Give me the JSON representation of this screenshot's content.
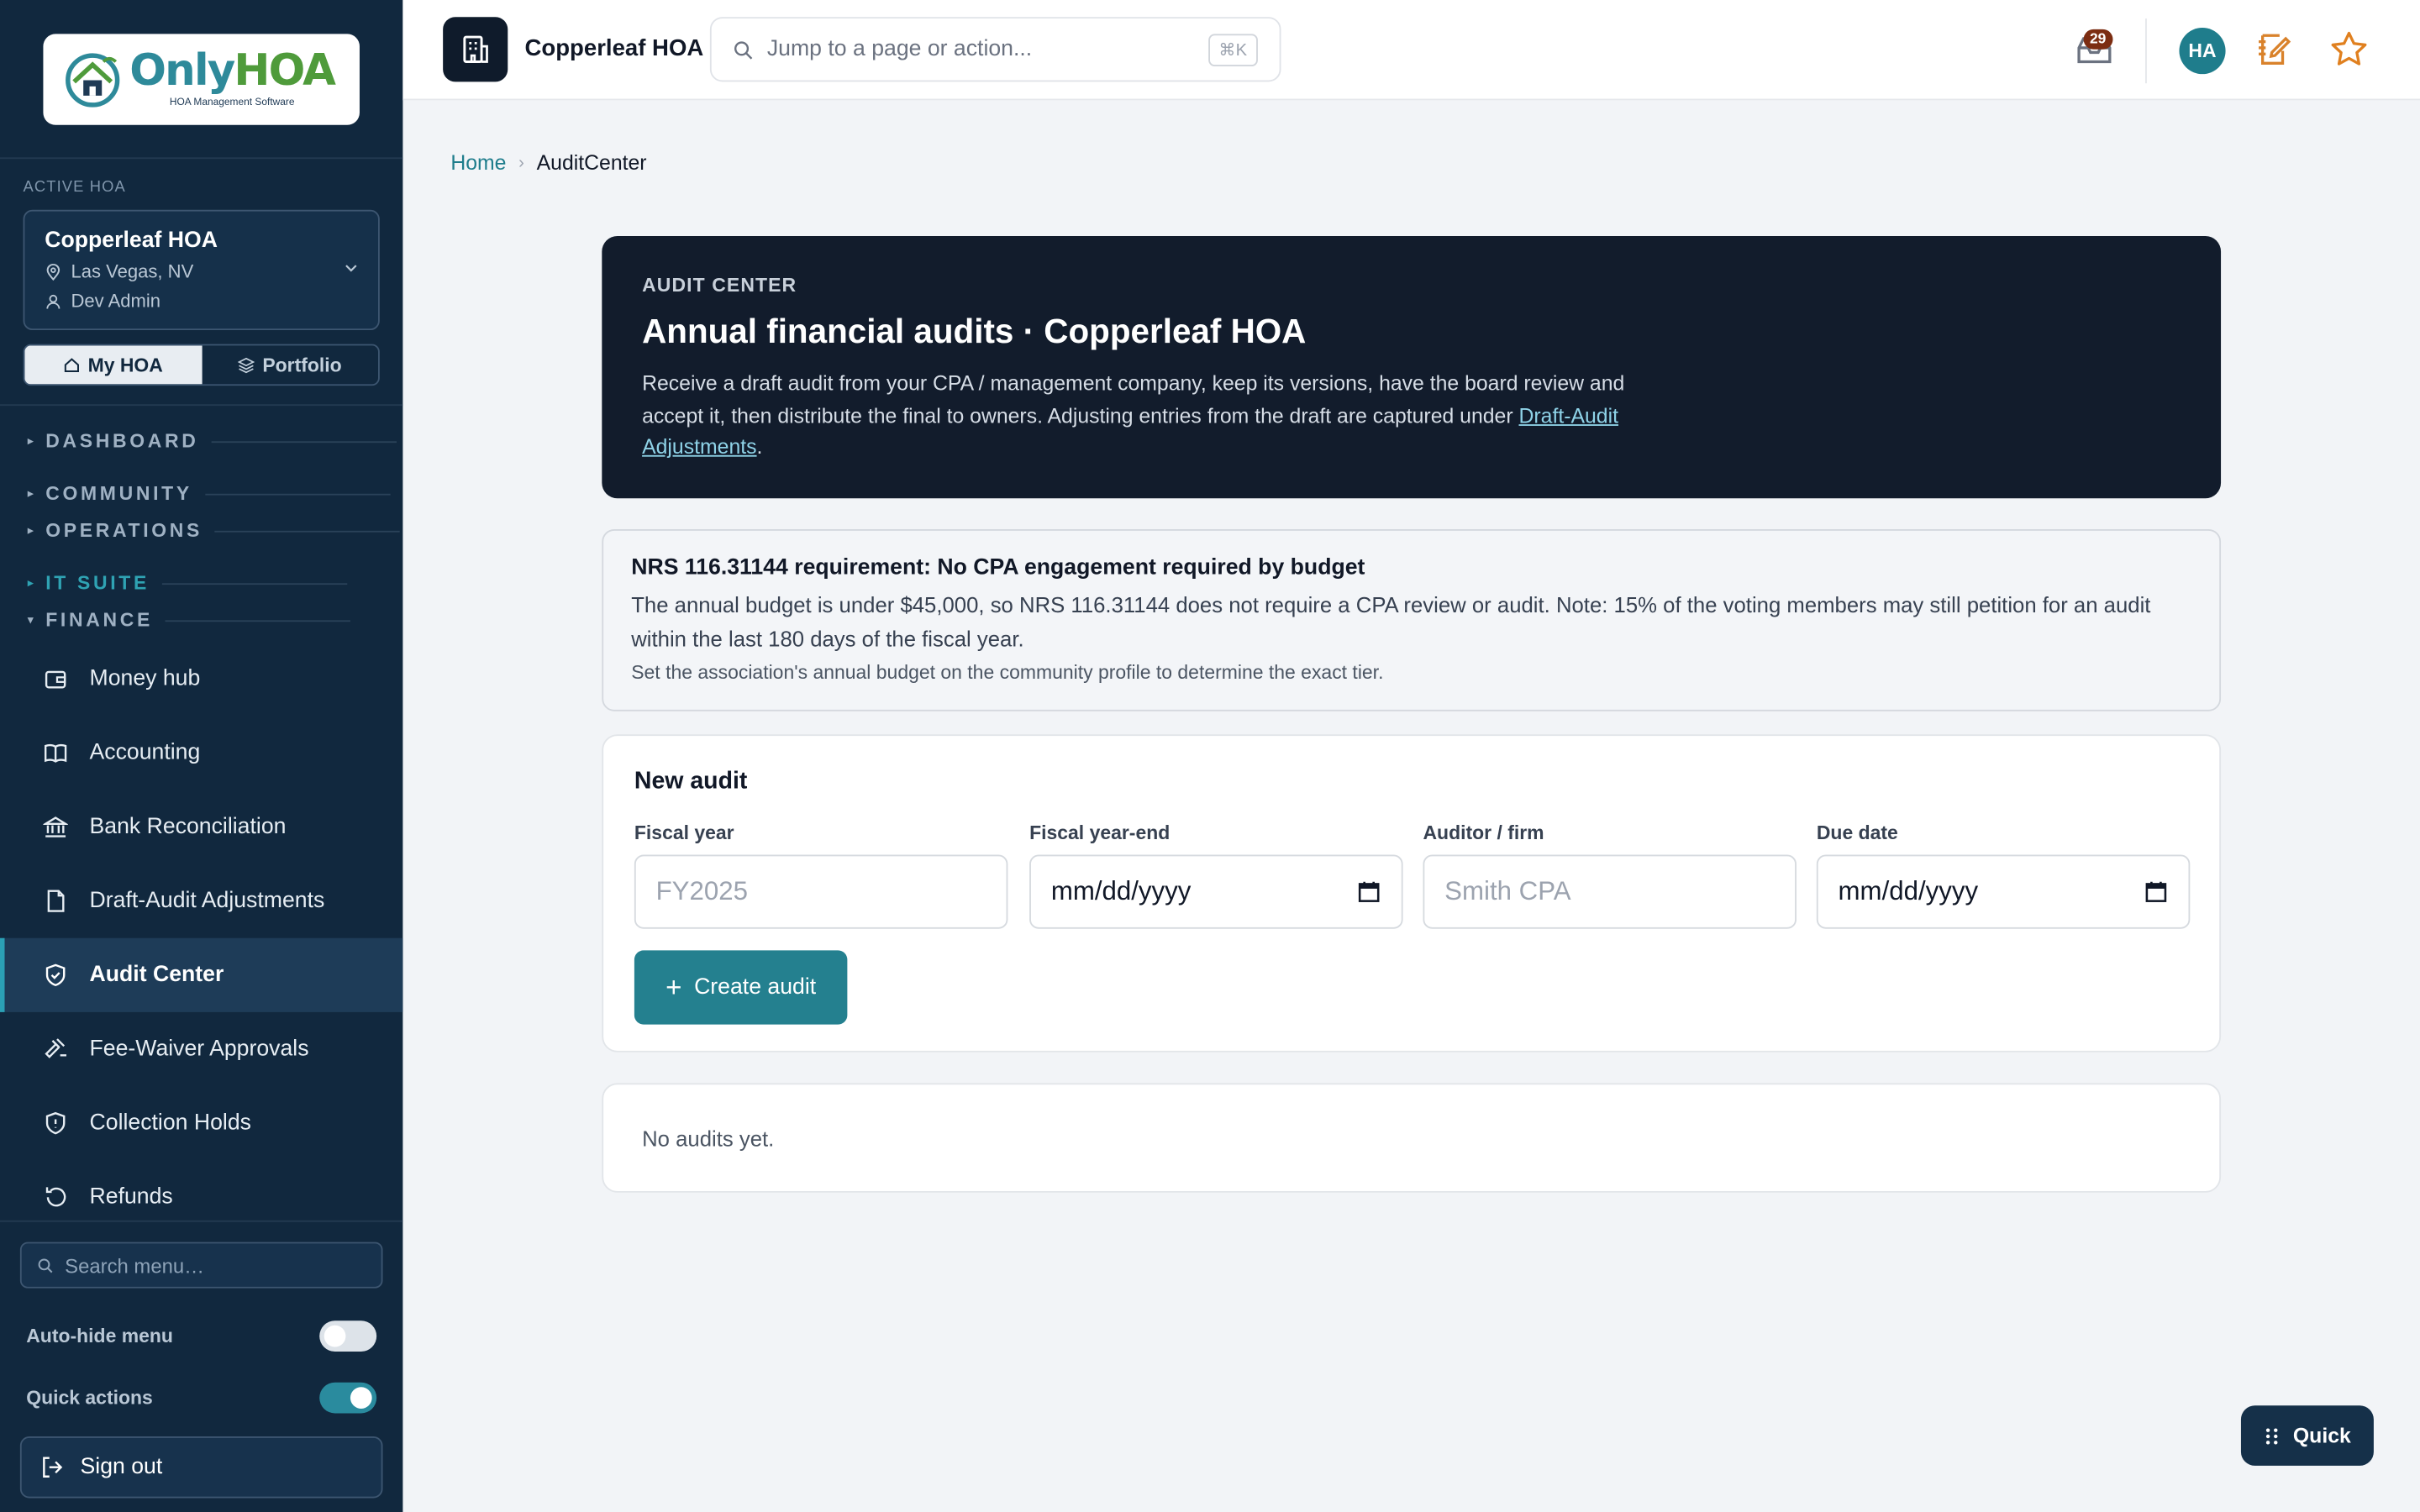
{
  "logo": {
    "word1": "Only",
    "word2": "HOA",
    "tagline": "HOA Management Software"
  },
  "sidebar": {
    "active_label": "ACTIVE HOA",
    "hoa": {
      "name": "Copperleaf HOA",
      "location": "Las Vegas, NV",
      "user": "Dev Admin"
    },
    "toggle": {
      "my_hoa": "My HOA",
      "portfolio": "Portfolio"
    },
    "sections": [
      "DASHBOARD",
      "COMMUNITY",
      "OPERATIONS",
      "IT SUITE",
      "FINANCE"
    ],
    "items": [
      {
        "label": "Money hub",
        "icon": "wallet-icon"
      },
      {
        "label": "Accounting",
        "icon": "book-icon"
      },
      {
        "label": "Bank Reconciliation",
        "icon": "bank-icon"
      },
      {
        "label": "Draft-Audit Adjustments",
        "icon": "document-icon"
      },
      {
        "label": "Audit Center",
        "icon": "shield-check-icon",
        "active": true
      },
      {
        "label": "Fee-Waiver Approvals",
        "icon": "gavel-icon"
      },
      {
        "label": "Collection Holds",
        "icon": "shield-icon"
      },
      {
        "label": "Refunds",
        "icon": "undo-icon"
      }
    ],
    "search_placeholder": "Search menu…",
    "auto_hide_label": "Auto-hide menu",
    "auto_hide_on": false,
    "quick_actions_label": "Quick actions",
    "quick_actions_on": true,
    "signout_label": "Sign out"
  },
  "topbar": {
    "title": "Copperleaf HOA",
    "search_placeholder": "Jump to a page or action...",
    "shortcut": "⌘K",
    "inbox_count": "29",
    "avatar_initials": "HA"
  },
  "breadcrumb": {
    "home": "Home",
    "current": "AuditCenter"
  },
  "hero": {
    "kicker": "AUDIT CENTER",
    "title": "Annual financial audits · Copperleaf HOA",
    "desc": "Receive a draft audit from your CPA / management company, keep its versions, have the board review and accept it, then distribute the final to owners. Adjusting entries from the draft are captured under ",
    "link": "Draft-Audit Adjustments",
    "desc_end": "."
  },
  "notice": {
    "title": "NRS 116.31144 requirement: No CPA engagement required by budget",
    "body": "The annual budget is under $45,000, so NRS 116.31144 does not require a CPA review or audit. Note: 15% of the voting members may still petition for an audit within the last 180 days of the fiscal year.",
    "small": "Set the association's annual budget on the community profile to determine the exact tier."
  },
  "new_audit": {
    "title": "New audit",
    "fiscal_year_label": "Fiscal year",
    "fiscal_year_placeholder": "FY2025",
    "fiscal_year_end_label": "Fiscal year-end",
    "fiscal_year_end_value": "mm/dd/yyyy",
    "auditor_label": "Auditor / firm",
    "auditor_placeholder": "Smith CPA",
    "due_date_label": "Due date",
    "due_date_value": "mm/dd/yyyy",
    "create_label": "Create audit"
  },
  "audits_empty": "No audits yet.",
  "quick_button": "Quick",
  "colors": {
    "sidebar": "#11283e",
    "accent": "#24808f",
    "hero": "#121c2c",
    "badge": "#7c2d12",
    "star": "#e0801f"
  }
}
